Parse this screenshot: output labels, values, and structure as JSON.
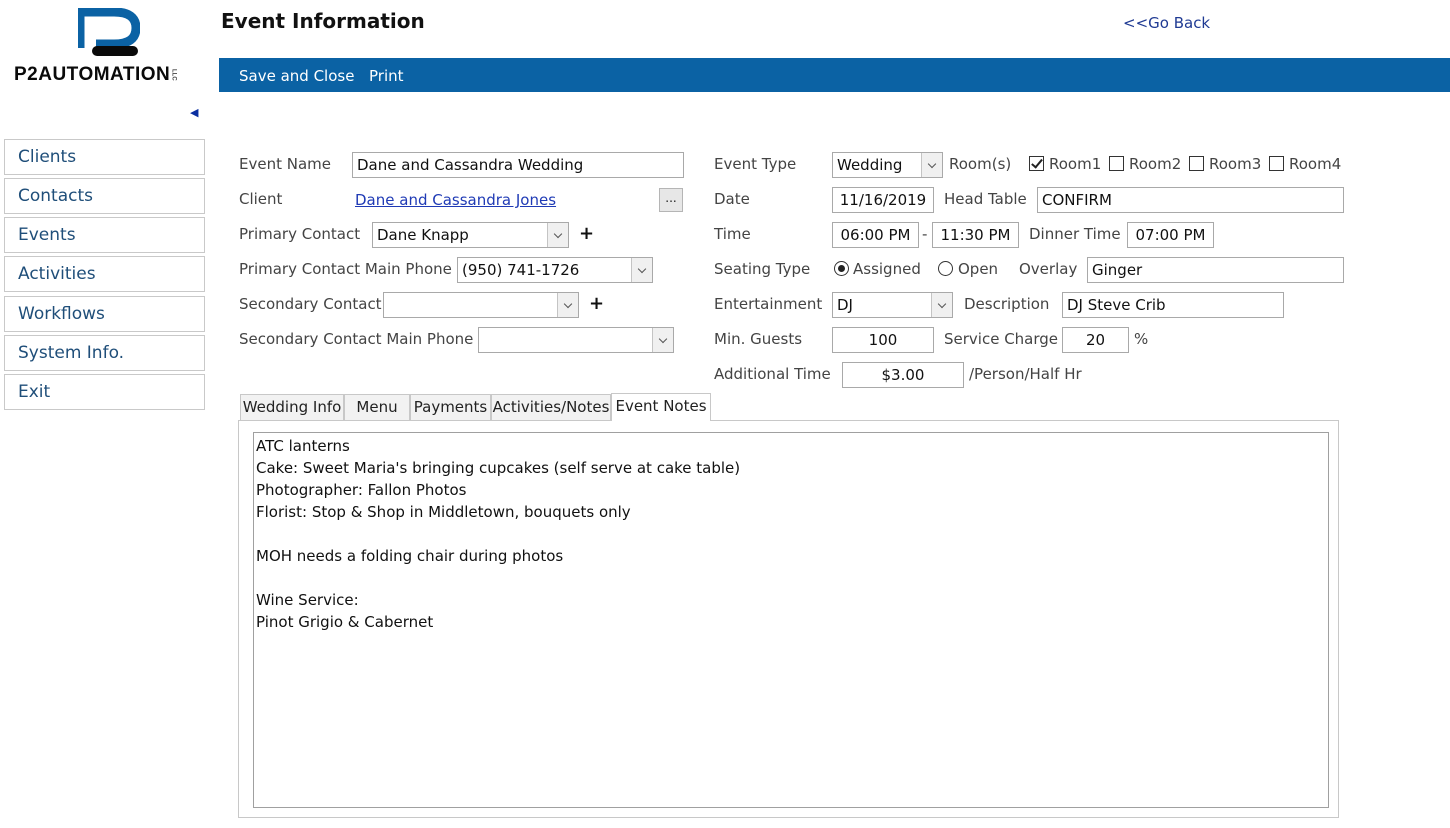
{
  "logo": {
    "text": "P2AUTOMATION",
    "suffix": "LLC"
  },
  "sidebar": {
    "items": [
      {
        "label": "Clients"
      },
      {
        "label": "Contacts"
      },
      {
        "label": "Events"
      },
      {
        "label": "Activities"
      },
      {
        "label": "Workflows"
      },
      {
        "label": "System Info."
      },
      {
        "label": "Exit"
      }
    ]
  },
  "header": {
    "title": "Event Information",
    "go_back": "<<Go Back"
  },
  "toolbar": {
    "save_close": "Save and Close",
    "print": "Print"
  },
  "form": {
    "event_name": {
      "label": "Event Name",
      "value": "Dane and Cassandra Wedding"
    },
    "client": {
      "label": "Client",
      "value": "Dane and Cassandra Jones",
      "browse": "..."
    },
    "primary_contact": {
      "label": "Primary Contact",
      "value": "Dane Knapp"
    },
    "primary_phone": {
      "label": "Primary Contact Main Phone",
      "value": "(950) 741-1726"
    },
    "secondary_contact": {
      "label": "Secondary Contact",
      "value": ""
    },
    "secondary_phone": {
      "label": "Secondary Contact Main Phone",
      "value": ""
    },
    "add_symbol": "+",
    "event_type": {
      "label": "Event Type",
      "value": "Wedding"
    },
    "rooms": {
      "label": "Room(s)",
      "items": [
        {
          "label": "Room1",
          "checked": true
        },
        {
          "label": "Room2",
          "checked": false
        },
        {
          "label": "Room3",
          "checked": false
        },
        {
          "label": "Room4",
          "checked": false
        }
      ]
    },
    "date": {
      "label": "Date",
      "value": "11/16/2019"
    },
    "head_table": {
      "label": "Head Table",
      "value": "CONFIRM"
    },
    "time": {
      "label": "Time",
      "start": "06:00 PM",
      "separator": "-",
      "end": "11:30 PM"
    },
    "dinner_time": {
      "label": "Dinner Time",
      "value": "07:00 PM"
    },
    "seating_type": {
      "label": "Seating Type",
      "options": [
        "Assigned",
        "Open"
      ],
      "selected": "Assigned"
    },
    "overlay": {
      "label": "Overlay",
      "value": "Ginger"
    },
    "entertainment": {
      "label": "Entertainment",
      "value": "DJ"
    },
    "description": {
      "label": "Description",
      "value": "DJ Steve Crib"
    },
    "min_guests": {
      "label": "Min. Guests",
      "value": "100"
    },
    "service_charge": {
      "label": "Service Charge",
      "value": "20",
      "unit": "%"
    },
    "additional_time": {
      "label": "Additional Time",
      "value": "$3.00",
      "unit": "/Person/Half Hr"
    }
  },
  "tabs": [
    {
      "label": "Wedding Info"
    },
    {
      "label": "Menu"
    },
    {
      "label": "Payments"
    },
    {
      "label": "Activities/Notes"
    },
    {
      "label": "Event Notes"
    }
  ],
  "active_tab": "Event Notes",
  "event_notes": [
    "ATC lanterns",
    "Cake: Sweet Maria's bringing cupcakes (self serve at cake table)",
    "Photographer: Fallon Photos",
    "Florist: Stop & Shop in Middletown, bouquets only",
    "",
    "MOH needs a folding chair during photos",
    "",
    "Wine Service:",
    "Pinot Grigio & Cabernet"
  ],
  "colors": {
    "toolbar_blue": "#0b62a4",
    "nav_text": "#1f4e79",
    "link_blue": "#1f3ab5",
    "logo_blue": "#0b62a4"
  }
}
